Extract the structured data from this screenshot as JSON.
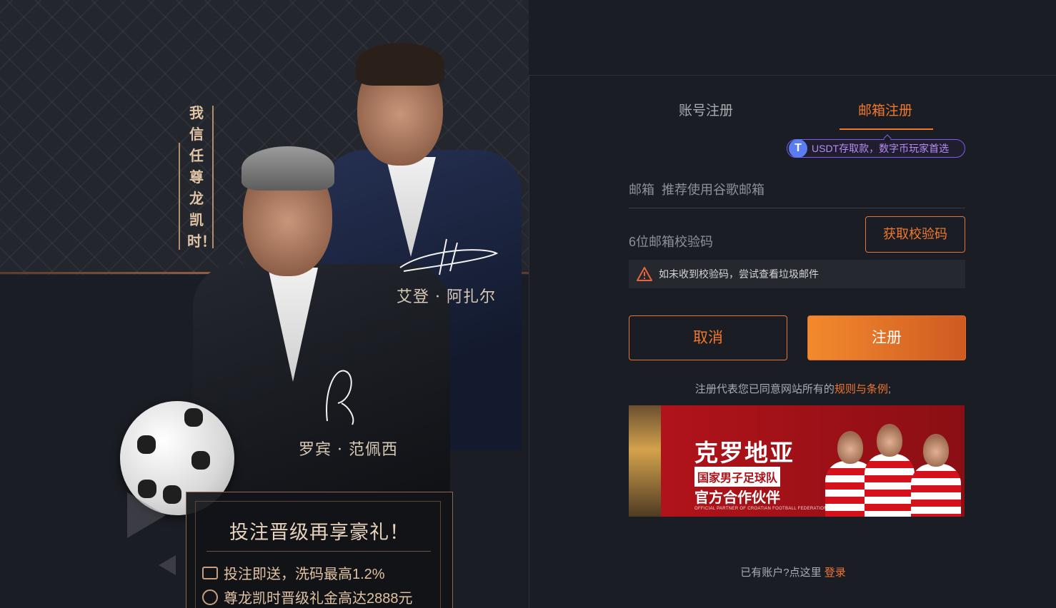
{
  "promo": {
    "slogan": "我信任尊龙凯时！",
    "player1_name": "艾登 · 阿扎尔",
    "player2_name": "罗宾 · 范佩西",
    "card_title": "投注晋级再享豪礼！",
    "card_line1": "投注即送，洗码最高1.2%",
    "card_line2": "尊龙凯时晋级礼金高达2888元"
  },
  "tabs": {
    "account": "账号注册",
    "email": "邮箱注册",
    "active": "email"
  },
  "usdt": {
    "icon_letter": "T",
    "text": "USDT存取款，数字币玩家首选"
  },
  "form": {
    "email_placeholder": "邮箱  推荐使用谷歌邮箱",
    "code_placeholder": "6位邮箱校验码",
    "get_code_label": "获取校验码",
    "hint": "如未收到校验码，尝试查看垃圾邮件",
    "cancel_label": "取消",
    "submit_label": "注册"
  },
  "terms": {
    "prefix": "注册代表您已同意网站所有的",
    "link": "规则与条例",
    "suffix": ";"
  },
  "banner": {
    "title": "克罗地亚",
    "sub1": "国家男子足球队",
    "sub2": "官方合作伙伴",
    "small": "OFFICIAL PARTNER OF CROATIAN FOOTBALL FEDERATION"
  },
  "login": {
    "prefix": "已有账户?点这里",
    "link": "登录"
  },
  "colors": {
    "accent": "#f0772c",
    "background": "#1b1d24",
    "usdt": "#7b5cf0"
  }
}
